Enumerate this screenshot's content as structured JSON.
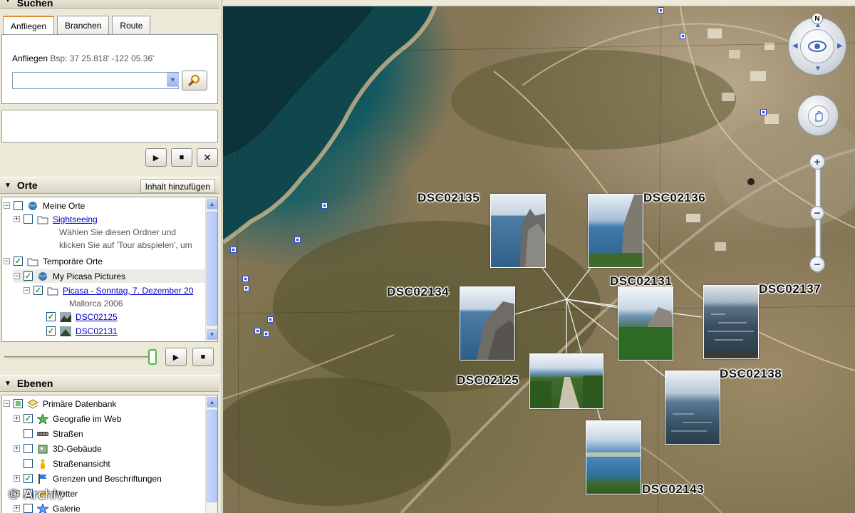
{
  "search": {
    "title": "Suchen",
    "tabs": [
      "Anfliegen",
      "Branchen",
      "Route"
    ],
    "hint_label": "Anfliegen",
    "hint_example": "Bsp: 37 25.818' -122 05.36'",
    "query": ""
  },
  "places": {
    "title": "Orte",
    "add_content": "Inhalt hinzufügen",
    "items": [
      {
        "label": "Meine Orte"
      },
      {
        "label": "Sightseeing",
        "desc1": "Wählen Sie diesen Ordner und",
        "desc2": "klicken Sie auf 'Tour abspielen', um"
      },
      {
        "label": "Temporäre Orte"
      },
      {
        "label": "My Picasa Pictures"
      },
      {
        "label": "Picasa - Sonntag, 7. Dezember 20",
        "desc": "Mallorca 2006"
      },
      {
        "label": "DSC02125"
      },
      {
        "label": "DSC02131"
      }
    ]
  },
  "layers": {
    "title": "Ebenen",
    "items": [
      {
        "label": "Primäre Datenbank"
      },
      {
        "label": "Geografie im Web"
      },
      {
        "label": "Straßen"
      },
      {
        "label": "3D-Gebäude"
      },
      {
        "label": "Straßenansicht"
      },
      {
        "label": "Grenzen und Beschriftungen"
      },
      {
        "label": "Wetter"
      },
      {
        "label": "Galerie"
      }
    ]
  },
  "map": {
    "compass_north": "N",
    "photos": [
      "DSC02135",
      "DSC02136",
      "DSC02134",
      "DSC02131",
      "DSC02137",
      "DSC02125",
      "DSC02138",
      "DSC02143"
    ]
  },
  "watermark": "© Archiv",
  "colors": {
    "accent_tab": "#e68b2c",
    "link": "#0000cc",
    "checkbox_green": "#21a121",
    "pin_blue": "#2a4bd0"
  }
}
